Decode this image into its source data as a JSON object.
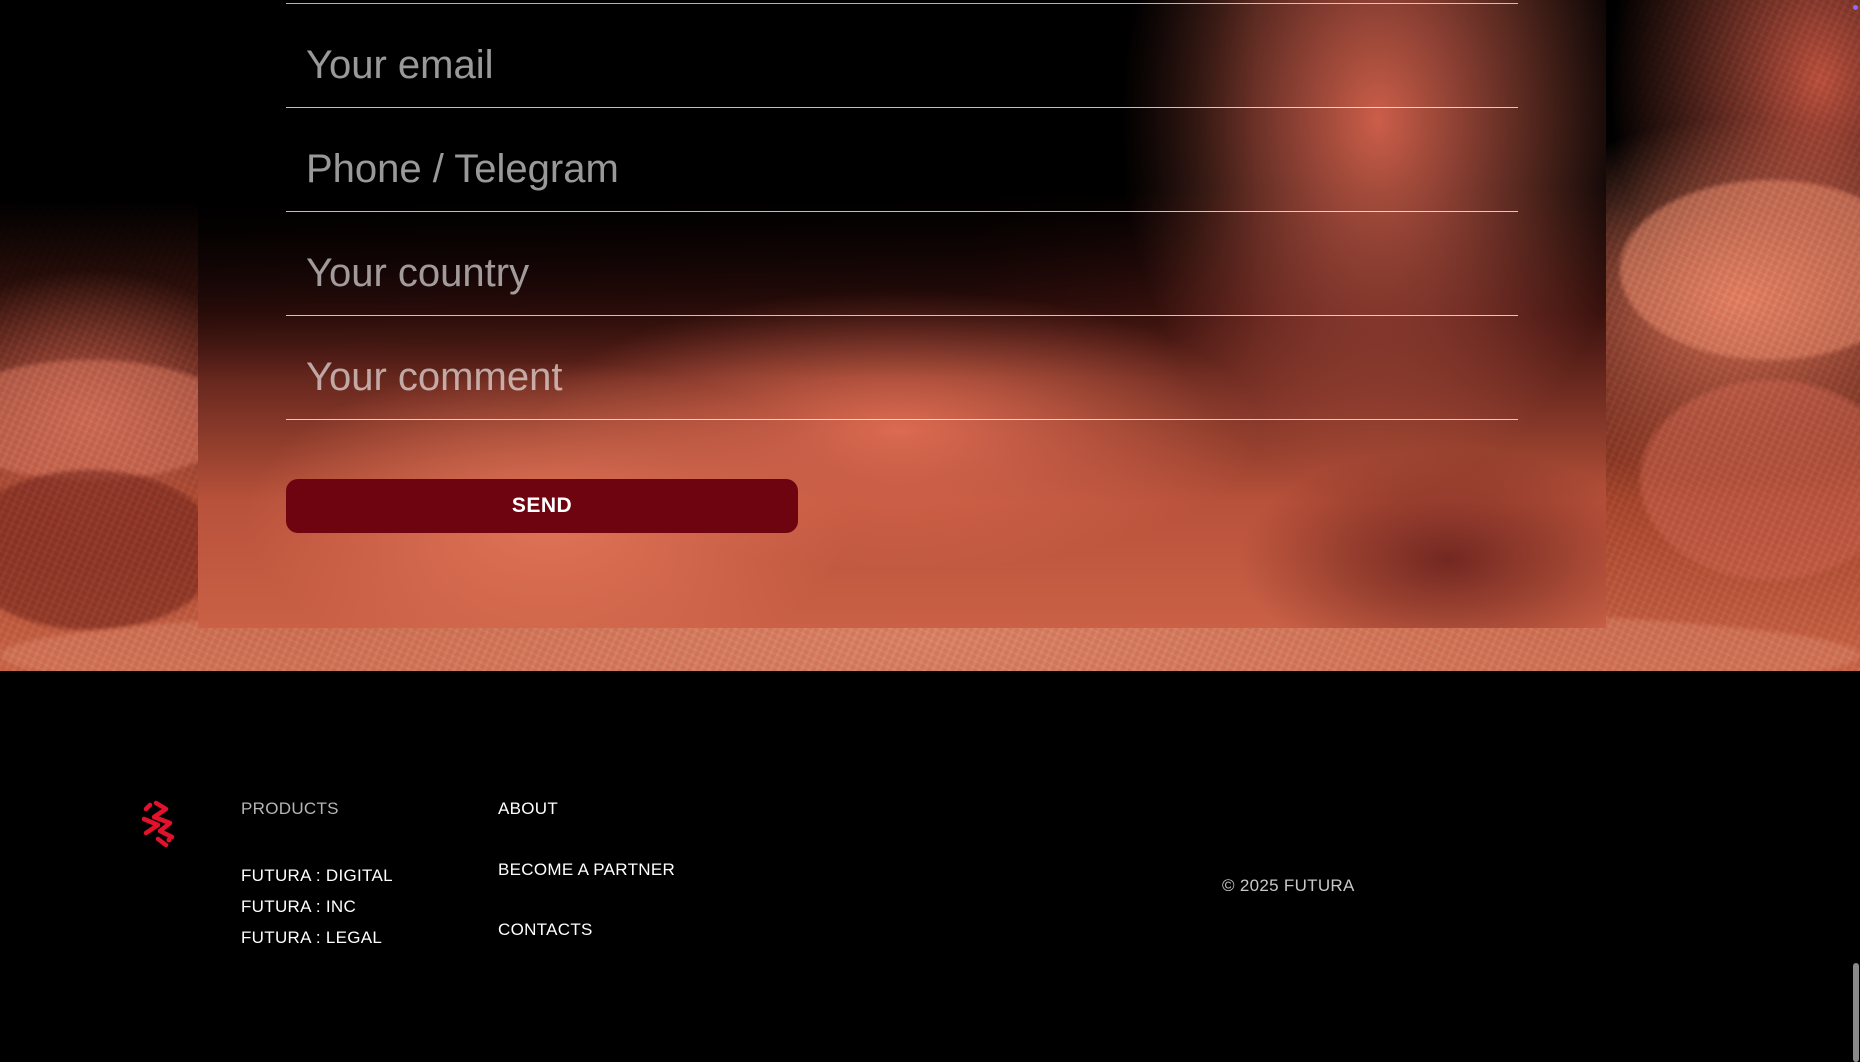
{
  "form": {
    "email_placeholder": "Your email",
    "phone_placeholder": "Phone / Telegram",
    "country_placeholder": "Your country",
    "comment_placeholder": "Your comment",
    "send_label": "SEND"
  },
  "footer": {
    "logo_icon": "futura-logo-icon",
    "products": {
      "heading": "PRODUCTS",
      "links": [
        "FUTURA : DIGITAL",
        "FUTURA : INC",
        "FUTURA : LEGAL"
      ]
    },
    "about": {
      "about_label": "ABOUT",
      "partner_label": "BECOME A PARTNER",
      "contacts_label": "CONTACTS"
    },
    "copyright": "©  2025 FUTURA"
  },
  "colors": {
    "background": "#000000",
    "button": "#6e0410",
    "logo": "#e4112d",
    "text": "#ffffff"
  }
}
